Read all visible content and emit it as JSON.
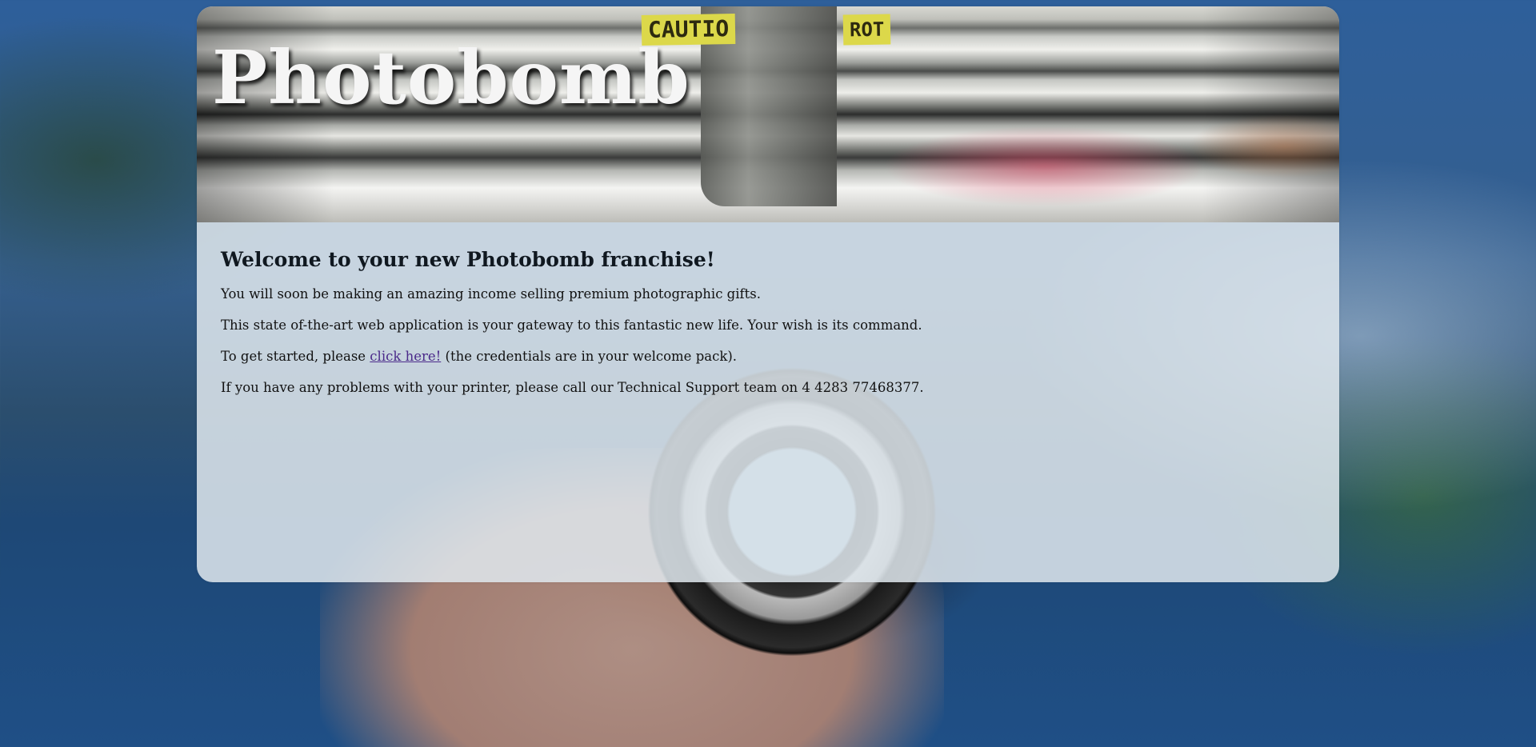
{
  "header": {
    "title": "Photobomb",
    "banner_labels": [
      "CAUTIO",
      "ROT"
    ]
  },
  "main": {
    "heading": "Welcome to your new Photobomb franchise!",
    "paragraph_1": "You will soon be making an amazing income selling premium photographic gifts.",
    "paragraph_2": "This state of-the-art web application is your gateway to this fantastic new life. Your wish is its command.",
    "paragraph_3_prefix": "To get started, please ",
    "paragraph_3_link": "click here!",
    "paragraph_3_suffix": " (the credentials are in your welcome pack).",
    "paragraph_4": "If you have any problems with your printer, please call our Technical Support team on 4 4283 77468377."
  },
  "colors": {
    "link": "#4b2a8a",
    "panel_bg": "#e0e8ee",
    "title_text": "#f5f5f5"
  }
}
